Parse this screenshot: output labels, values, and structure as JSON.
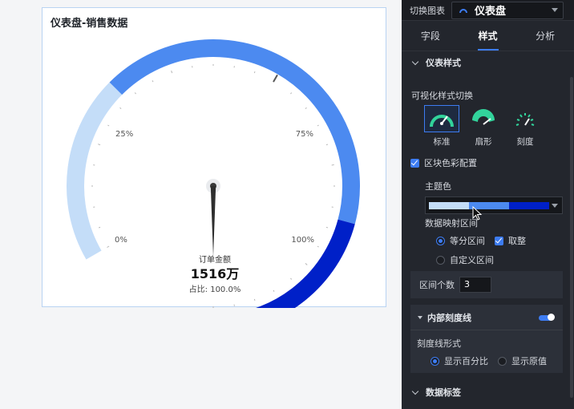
{
  "chart_card": {
    "title": "仪表盘-销售数据",
    "measure_label": "订单金额",
    "value": "1516万",
    "ratio_text": "占比: 100.0%",
    "tick_labels": {
      "p0": "0%",
      "p25": "25%",
      "p75": "75%",
      "p100": "100%"
    },
    "colors": [
      "#c4ddf8",
      "#4c8af0",
      "#0020c8"
    ]
  },
  "chart_data": {
    "type": "gauge",
    "title": "仪表盘-销售数据",
    "measure": "订单金额",
    "value_text": "1516万",
    "percent": 100.0,
    "range_percent": [
      0,
      100
    ],
    "tick_labels": [
      "0%",
      "25%",
      "75%",
      "100%"
    ],
    "color_bands": [
      {
        "from": 0,
        "to": 25,
        "color": "#c4ddf8"
      },
      {
        "from": 25,
        "to": 75,
        "color": "#4c8af0"
      },
      {
        "from": 75,
        "to": 100,
        "color": "#0020c8"
      }
    ]
  },
  "panel": {
    "switch_label": "切换图表",
    "chart_type": "仪表盘",
    "tabs": [
      "字段",
      "样式",
      "分析"
    ],
    "gauge_style_section": "仪表样式",
    "style_switch_label": "可视化样式切换",
    "style_options": [
      "标准",
      "扇形",
      "刻度"
    ],
    "block_color_config": "区块色彩配置",
    "theme_color_label": "主题色",
    "theme_colors": [
      "#c4ddf8",
      "#4c8af0",
      "#0020c8"
    ],
    "mapping_label": "数据映射区间",
    "equal_interval": "等分区间",
    "round_label": "取整",
    "custom_interval": "自定义区间",
    "interval_count_label": "区间个数",
    "interval_count": "3",
    "inner_tick_label": "内部刻度线",
    "tick_form_label": "刻度线形式",
    "show_percent": "显示百分比",
    "show_raw": "显示原值",
    "data_label_section": "数据标签"
  }
}
